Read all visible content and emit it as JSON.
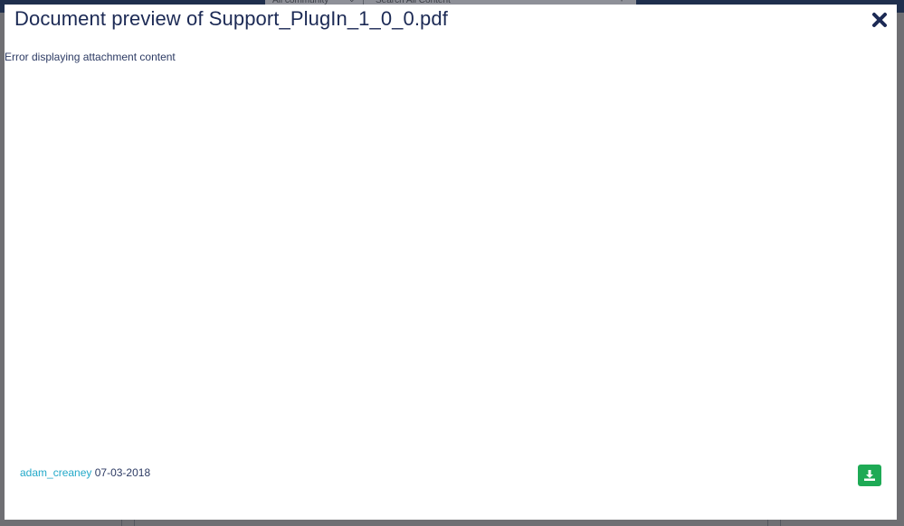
{
  "background": {
    "search_scope": "All community",
    "search_placeholder": "Search All Content",
    "header_color": "#1f2f4d"
  },
  "modal": {
    "title": "Document preview of Support_PlugIn_1_0_0.pdf",
    "close_icon": "close-icon",
    "error_message": "Error displaying attachment content",
    "author": "adam_creaney",
    "date": "07-03-2018",
    "download_icon": "download-icon",
    "title_color": "#1c2a55",
    "link_color": "#23a9c9",
    "download_color": "#1eaa55"
  }
}
